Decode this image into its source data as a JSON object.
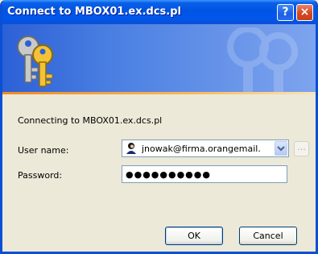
{
  "window": {
    "title": "Connect to MBOX01.ex.dcs.pl"
  },
  "titlebar": {
    "help_glyph": "?",
    "close_glyph": "×"
  },
  "banner": {
    "icon": "keys-icon",
    "accent_color": "#f08a24"
  },
  "form": {
    "connecting_text": "Connecting to MBOX01.ex.dcs.pl",
    "user_label": "User name:",
    "user_value": "jnowak@firma.orangemail.",
    "user_icon": "user-icon",
    "browse_label": "...",
    "password_label": "Password:",
    "password_mask": "●●●●●●●●●●"
  },
  "buttons": {
    "ok": "OK",
    "cancel": "Cancel"
  }
}
